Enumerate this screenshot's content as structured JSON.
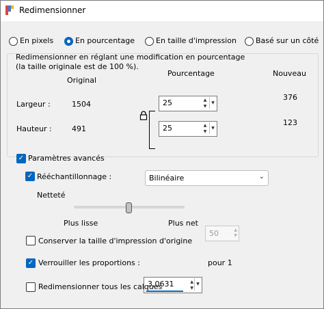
{
  "window": {
    "title": "Redimensionner",
    "icon": "paintshop-app-icon"
  },
  "modes": [
    {
      "label": "En pixels",
      "checked": false
    },
    {
      "label": "En pourcentage",
      "checked": true
    },
    {
      "label": "En taille d'impression",
      "checked": false
    },
    {
      "label": "Basé sur un côté",
      "checked": false
    }
  ],
  "percent_group": {
    "heading1": "Redimensionner en réglant une modification en pourcentage",
    "heading2": "(la taille originale est de 100 %).",
    "col_original": "Original",
    "col_percent": "Pourcentage",
    "col_new": "Nouveau",
    "width": {
      "label": "Largeur :",
      "original": "1504",
      "percent": "25",
      "new": "376"
    },
    "height": {
      "label": "Hauteur :",
      "original": "491",
      "percent": "25",
      "new": "123"
    },
    "link_icon": "lock-icon"
  },
  "advanced": {
    "label": "Paramètres avancés",
    "checked": true,
    "resample": {
      "label": "Rééchantillonnage :",
      "checked": true,
      "method": "Bilinéaire"
    },
    "sharpness": {
      "label": "Netteté",
      "value": "50",
      "level": 50,
      "min_label": "Plus lisse",
      "max_label": "Plus net"
    },
    "keep_print_size": {
      "label": "Conserver la taille d'impression d'origine",
      "checked": false
    },
    "lock_ratio": {
      "label": "Verrouiller les proportions :",
      "checked": true,
      "value": "3,0631",
      "suffix": "pour 1"
    },
    "resize_all_layers": {
      "label": "Redimensionner tous les calques",
      "checked": false
    }
  },
  "colors": {
    "accent": "#0067c0",
    "background": "#f0f0f0"
  }
}
